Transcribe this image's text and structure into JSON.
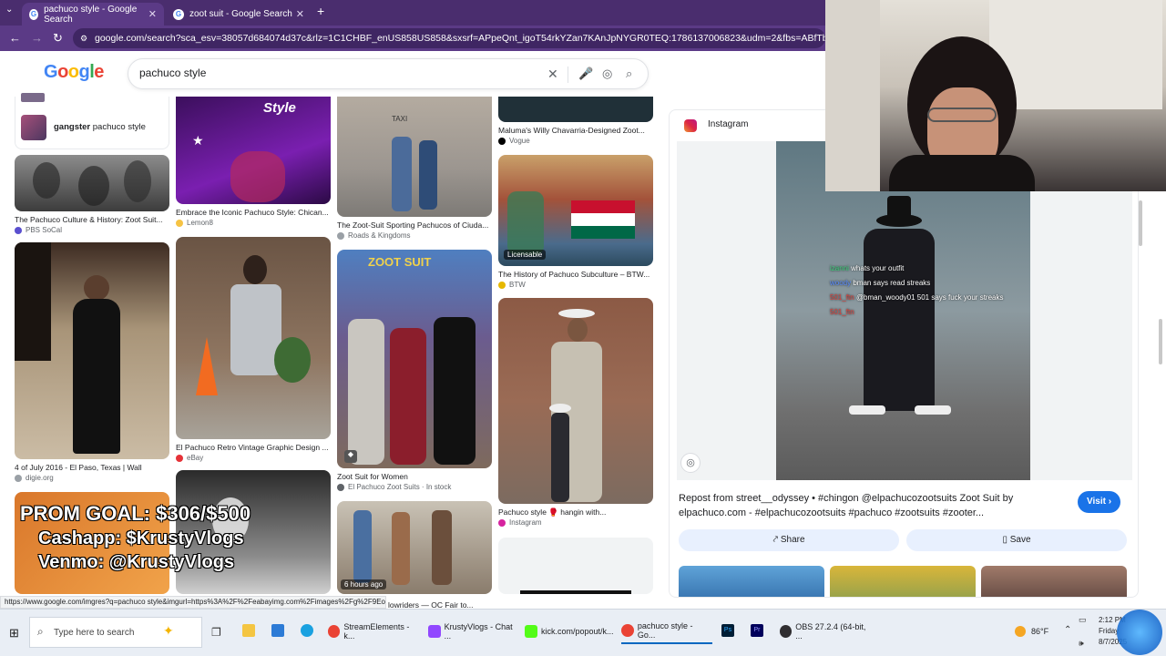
{
  "browser": {
    "tabs": [
      {
        "label": "pachuco style - Google Search",
        "active": true
      },
      {
        "label": "zoot suit - Google Search",
        "active": false
      }
    ],
    "new_tab": "+",
    "url": "google.com/search?sca_esv=38057d684074d37c&rlz=1C1CHBF_enUS858US858&sxsrf=APpeQnt_igoT54rkYZan7KAnJpNYGR0TEQ:1786137006823&udm=2&fbs=ABfTbFVyMZGZf1hfvX9uKjN_-G0"
  },
  "google": {
    "logo": "Google",
    "query": "pachuco style"
  },
  "results": {
    "col1": {
      "suggestion_bold": "gangster",
      "suggestion_rest": " pachuco style",
      "items": [
        {
          "caption": "The Pachuco Culture & History: Zoot Suit...",
          "source": "PBS SoCal"
        },
        {
          "caption": "4 of July 2016 - El Paso, Texas | Wall",
          "source": "digie.org"
        }
      ],
      "overlay_goal": "PROM GOAL: $306/$500",
      "overlay_cashapp": "Cashapp: $KrustyVlogs",
      "overlay_venmo": "Venmo: @KrustyVlogs"
    },
    "col2": {
      "items": [
        {
          "caption": "Embrace the Iconic Pachuco Style: Chican...",
          "source": "Lemon8",
          "image_text": "Style"
        },
        {
          "caption": "El Pachuco Retro Vintage Graphic Design ...",
          "source": "eBay"
        }
      ]
    },
    "col3": {
      "items": [
        {
          "caption": "The Zoot-Suit Sporting Pachucos of Ciuda...",
          "source": "Roads & Kingdoms"
        },
        {
          "caption": "Zoot Suit for Women",
          "source": "El Pachuco Zoot Suits · In stock",
          "image_text": "ZOOT SUIT"
        },
        {
          "caption": "lowriders — OC Fair to...",
          "badge": "6 hours ago"
        }
      ]
    },
    "col4": {
      "items": [
        {
          "caption": "Maluma's Willy Chavarria-Designed Zoot...",
          "source": "Vogue"
        },
        {
          "caption": "The History of Pachuco Subculture – BTW...",
          "source": "BTW",
          "badge": "Licensable"
        },
        {
          "caption": "Pachuco style 🥊 hangin with...",
          "source": "Instagram"
        }
      ]
    }
  },
  "panel": {
    "source": "Instagram",
    "description": "Repost from street__odyssey • #chingon @elpachucozootsuits Zoot Suit by elpachuco.com - #elpachucozootsuits #pachuco #zootsuits #zooter...",
    "visit": "Visit",
    "share": "Share",
    "save": "Save",
    "chat": [
      {
        "user": "izanni",
        "text": "whats your outfit"
      },
      {
        "user": "woody",
        "text": "bman says read streaks"
      },
      {
        "user": "501_ftn",
        "text": "@bman_woody01 501 says fuck your streaks"
      },
      {
        "user": "501_ftn",
        "text": ""
      }
    ]
  },
  "status_url": "https://www.google.com/imgres?q=pachuco style&imgurl=https%3A%2F%2Feabayimg.com%2Fimages%2Fg%2F9Eo...",
  "taskbar": {
    "search_placeholder": "Type here to search",
    "apps": [
      {
        "label": "StreamElements - k...",
        "color": "#6b3fa0"
      },
      {
        "label": "KrustyVlogs - Chat ...",
        "color": "#9147ff"
      },
      {
        "label": "kick.com/popout/k...",
        "color": "#53fc18"
      },
      {
        "label": "pachuco style - Go...",
        "color": "#ea4335"
      },
      {
        "label": "OBS 27.2.4 (64-bit, ...",
        "color": "#302e31"
      }
    ],
    "weather": "86°F",
    "time": "2:12 PM",
    "day": "Friday",
    "date": "8/7/2025"
  },
  "colors": {
    "tab_bg": "#4a2d6e",
    "link_blue": "#1a73e8"
  }
}
